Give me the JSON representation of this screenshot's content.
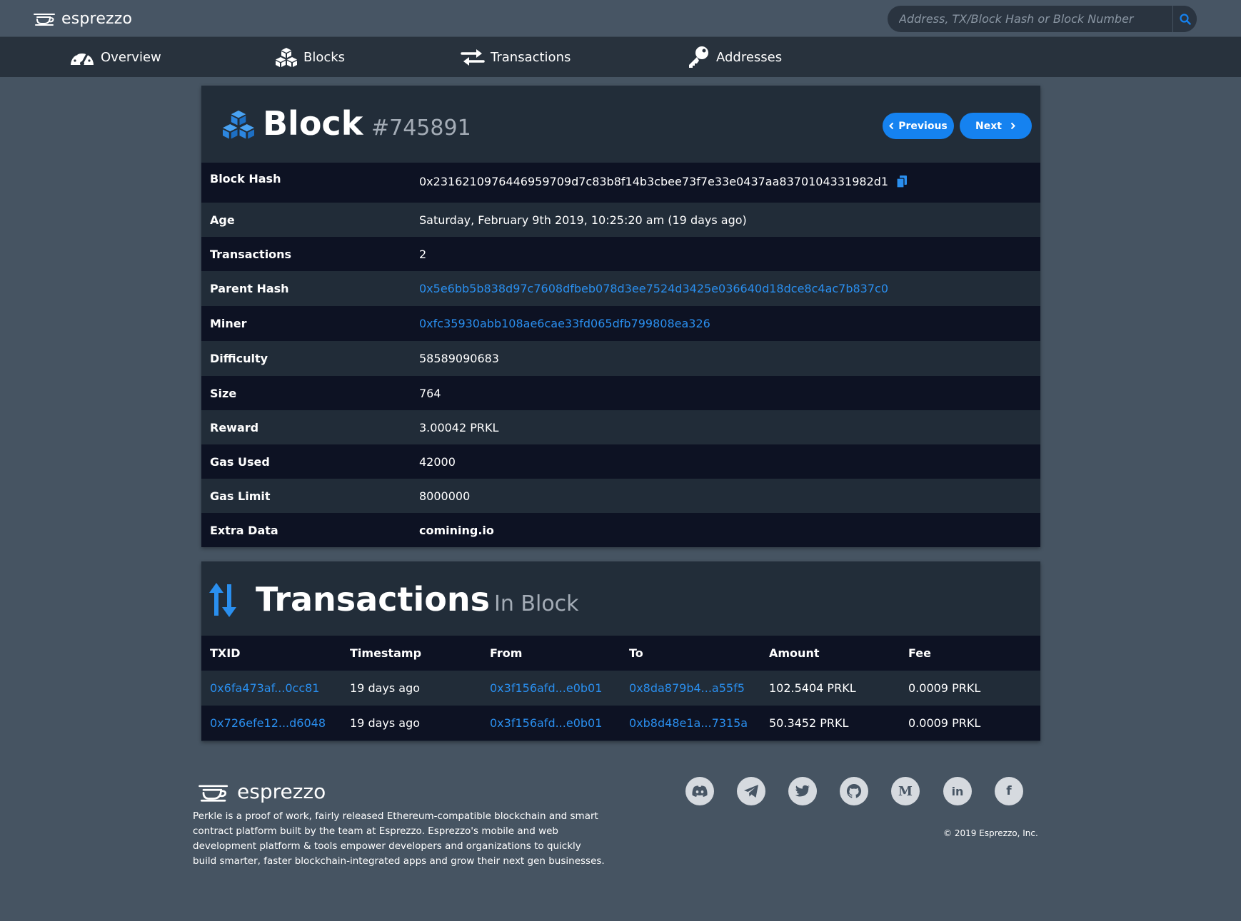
{
  "brand": {
    "name": "esprezzo"
  },
  "search": {
    "placeholder": "Address, TX/Block Hash or Block Number"
  },
  "nav": {
    "overview": "Overview",
    "blocks": "Blocks",
    "transactions": "Transactions",
    "addresses": "Addresses"
  },
  "block": {
    "title": "Block",
    "number": "#745891",
    "prev_label": "Previous",
    "next_label": "Next",
    "rows": [
      {
        "label": "Block Hash",
        "value": "0x2316210976446959709d7c83b8f14b3cbee73f7e33e0437aa8370104331982d1"
      },
      {
        "label": "Age",
        "value": "Saturday, February 9th 2019, 10:25:20 am (19 days ago)"
      },
      {
        "label": "Transactions",
        "value": "2"
      },
      {
        "label": "Parent Hash",
        "value": "0x5e6bb5b838d97c7608dfbeb078d3ee7524d3425e036640d18dce8c4ac7b837c0"
      },
      {
        "label": "Miner",
        "value": "0xfc35930abb108ae6cae33fd065dfb799808ea326"
      },
      {
        "label": "Difficulty",
        "value": "58589090683"
      },
      {
        "label": "Size",
        "value": "764"
      },
      {
        "label": "Reward",
        "value": "3.00042 PRKL"
      },
      {
        "label": "Gas Used",
        "value": "42000"
      },
      {
        "label": "Gas Limit",
        "value": "8000000"
      },
      {
        "label": "Extra Data",
        "value": "comining.io"
      }
    ]
  },
  "transactions": {
    "title": "Transactions",
    "subtitle": "In Block",
    "columns": [
      "TXID",
      "Timestamp",
      "From",
      "To",
      "Amount",
      "Fee"
    ],
    "rows": [
      {
        "txid": "0x6fa473af...0cc81",
        "timestamp": "19 days ago",
        "from": "0x3f156afd...e0b01",
        "to": "0x8da879b4...a55f5",
        "amount": "102.5404 PRKL",
        "fee": "0.0009 PRKL"
      },
      {
        "txid": "0x726efe12...d6048",
        "timestamp": "19 days ago",
        "from": "0x3f156afd...e0b01",
        "to": "0xb8d48e1a...7315a",
        "amount": "50.3452 PRKL",
        "fee": "0.0009 PRKL"
      }
    ]
  },
  "footer": {
    "description": "Perkle is a proof of work, fairly released Ethereum-compatible blockchain and smart contract platform built by the team at Esprezzo. Esprezzo's mobile and web development platform & tools empower developers and organizations to quickly build smarter, faster blockchain-integrated apps and grow their next gen businesses.",
    "copyright": "© 2019 Esprezzo, Inc.",
    "social_icons": [
      "discord-icon",
      "telegram-icon",
      "twitter-icon",
      "github-icon",
      "medium-icon",
      "linkedin-icon",
      "facebook-icon"
    ],
    "medium_glyph": "M",
    "linkedin_glyph": "in",
    "facebook_glyph": "f"
  },
  "colors": {
    "background": "#465462",
    "navbar": "#28323d",
    "card": "#222d39",
    "row_dark": "#0d1223",
    "row_light": "#212c38",
    "accent": "#1582f0",
    "link": "#2a8fef"
  }
}
